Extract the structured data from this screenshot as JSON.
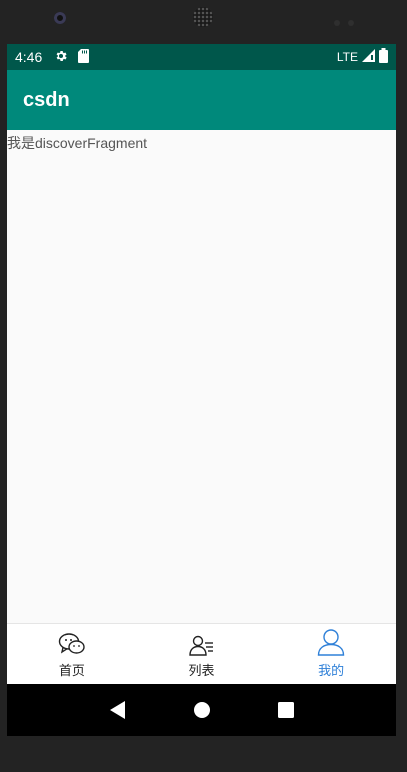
{
  "status_bar": {
    "time": "4:46",
    "network": "LTE",
    "icons": [
      "gear-icon",
      "sd-card-icon",
      "signal-icon",
      "battery-icon"
    ]
  },
  "app_bar": {
    "title": "csdn"
  },
  "content": {
    "fragment_text": "我是discoverFragment"
  },
  "bottom_nav": {
    "items": [
      {
        "label": "首页",
        "icon": "chat-bubbles-icon"
      },
      {
        "label": "列表",
        "icon": "contact-list-icon"
      },
      {
        "label": "我的",
        "icon": "user-icon",
        "active": true
      }
    ],
    "active_color": "#2f80d8"
  },
  "system_nav": {
    "buttons": [
      "back-icon",
      "home-icon",
      "recents-icon"
    ]
  },
  "colors": {
    "status_bar": "#00574b",
    "app_bar": "#00897b"
  }
}
